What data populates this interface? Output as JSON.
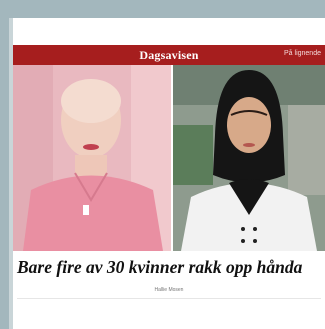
{
  "masthead": {
    "logo": "Dagsavisen",
    "right_label": "På lignende"
  },
  "article": {
    "headline": "Bare fire av 30 kvinner rakk opp hånda",
    "byline": "Hallie Mosen"
  },
  "images": {
    "left_alt": "woman-bald-pink-shirt",
    "right_alt": "woman-hijab-white-blazer"
  }
}
